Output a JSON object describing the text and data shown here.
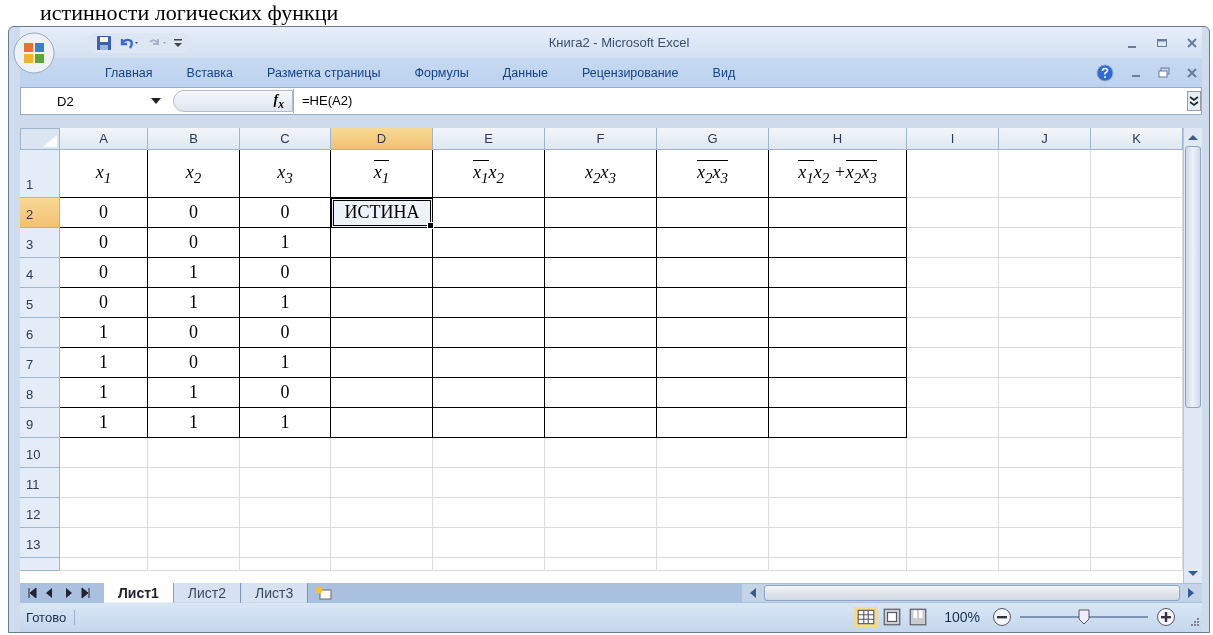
{
  "caption": "истинности логических функци",
  "window": {
    "title": "Книга2 - Microsoft Excel"
  },
  "ribbon_tabs": [
    {
      "label": "Главная"
    },
    {
      "label": "Вставка"
    },
    {
      "label": "Разметка страницы"
    },
    {
      "label": "Формулы"
    },
    {
      "label": "Данные"
    },
    {
      "label": "Рецензирование"
    },
    {
      "label": "Вид"
    }
  ],
  "formula_bar": {
    "name_box": "D2",
    "function_label": "f$_{x}$",
    "formula": "=НЕ(A2)"
  },
  "columns": [
    {
      "label": "A",
      "selected": false
    },
    {
      "label": "B",
      "selected": false
    },
    {
      "label": "C",
      "selected": false
    },
    {
      "label": "D",
      "selected": true
    },
    {
      "label": "E",
      "selected": false
    },
    {
      "label": "F",
      "selected": false
    },
    {
      "label": "G",
      "selected": false
    },
    {
      "label": "H",
      "selected": false
    },
    {
      "label": "I",
      "selected": false
    },
    {
      "label": "J",
      "selected": false
    },
    {
      "label": "K",
      "selected": false
    }
  ],
  "header_row": {
    "label": "1",
    "cells": [
      [
        {
          "text": "x$_{1}$",
          "overline": false
        }
      ],
      [
        {
          "text": "x$_{2}$",
          "overline": false
        }
      ],
      [
        {
          "text": "x$_{3}$",
          "overline": false
        }
      ],
      [
        {
          "text": "x$_{1}$",
          "overline": true
        }
      ],
      [
        {
          "text": "x$_{1}$",
          "overline": true
        },
        {
          "text": "x$_{2}$",
          "overline": false
        }
      ],
      [
        {
          "text": "x$_{2}$x$_{3}$",
          "overline": false
        }
      ],
      [
        {
          "text": "x$_{2}$x$_{3}$",
          "overline": true
        }
      ],
      [
        {
          "text": "x$_{1}$",
          "overline": true
        },
        {
          "text": "x$_{2}$ + ",
          "overline": false
        },
        {
          "text": "x$_{2}$x$_{3}$",
          "overline": true
        }
      ]
    ]
  },
  "rows": [
    {
      "label": "2",
      "selected": true,
      "bordered": true,
      "cells": [
        {
          "text": "0",
          "selected": false
        },
        {
          "text": "0",
          "selected": false
        },
        {
          "text": "0",
          "selected": false
        },
        {
          "text": "ИСТИНА",
          "selected": true
        }
      ]
    },
    {
      "label": "3",
      "selected": false,
      "bordered": true,
      "cells": [
        {
          "text": "0",
          "selected": false
        },
        {
          "text": "0",
          "selected": false
        },
        {
          "text": "1",
          "selected": false
        }
      ]
    },
    {
      "label": "4",
      "selected": false,
      "bordered": true,
      "cells": [
        {
          "text": "0",
          "selected": false
        },
        {
          "text": "1",
          "selected": false
        },
        {
          "text": "0",
          "selected": false
        }
      ]
    },
    {
      "label": "5",
      "selected": false,
      "bordered": true,
      "cells": [
        {
          "text": "0",
          "selected": false
        },
        {
          "text": "1",
          "selected": false
        },
        {
          "text": "1",
          "selected": false
        }
      ]
    },
    {
      "label": "6",
      "selected": false,
      "bordered": true,
      "cells": [
        {
          "text": "1",
          "selected": false
        },
        {
          "text": "0",
          "selected": false
        },
        {
          "text": "0",
          "selected": false
        }
      ]
    },
    {
      "label": "7",
      "selected": false,
      "bordered": true,
      "cells": [
        {
          "text": "1",
          "selected": false
        },
        {
          "text": "0",
          "selected": false
        },
        {
          "text": "1",
          "selected": false
        }
      ]
    },
    {
      "label": "8",
      "selected": false,
      "bordered": true,
      "cells": [
        {
          "text": "1",
          "selected": false
        },
        {
          "text": "1",
          "selected": false
        },
        {
          "text": "0",
          "selected": false
        }
      ]
    },
    {
      "label": "9",
      "selected": false,
      "bordered": true,
      "cells": [
        {
          "text": "1",
          "selected": false
        },
        {
          "text": "1",
          "selected": false
        },
        {
          "text": "1",
          "selected": false
        }
      ]
    },
    {
      "label": "10",
      "selected": false,
      "bordered": false
    },
    {
      "label": "11",
      "selected": false,
      "bordered": false
    },
    {
      "label": "12",
      "selected": false,
      "bordered": false
    },
    {
      "label": "13",
      "selected": false,
      "bordered": false
    }
  ],
  "sheet_tabs": [
    {
      "label": "Лист1",
      "selected": true
    },
    {
      "label": "Лист2",
      "selected": false
    },
    {
      "label": "Лист3",
      "selected": false
    }
  ],
  "status_bar": {
    "status": "Готово",
    "zoom": "100%",
    "zoom_level": {
      "level": 0.5
    }
  }
}
